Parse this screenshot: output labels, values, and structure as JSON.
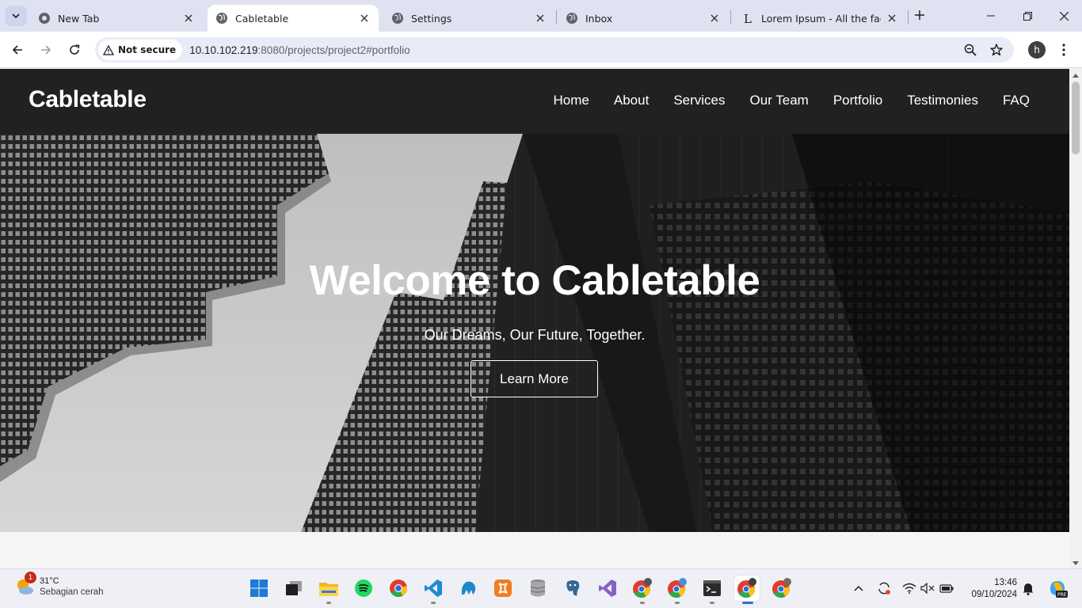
{
  "browser": {
    "tabs": [
      {
        "title": "New Tab",
        "icon": "chrome-icon"
      },
      {
        "title": "Cabletable",
        "icon": "globe-icon",
        "active": true
      },
      {
        "title": "Settings",
        "icon": "settings-globe-icon"
      },
      {
        "title": "Inbox",
        "icon": "globe-icon"
      },
      {
        "title": "Lorem Ipsum - All the facts -",
        "icon": "lorem-l-icon"
      }
    ],
    "security_label": "Not secure",
    "url_host": "10.10.102.219",
    "url_path": ":8080/projects/project2#portfolio",
    "profile_initial": "h"
  },
  "site": {
    "brand": "Cabletable",
    "nav": [
      "Home",
      "About",
      "Services",
      "Our Team",
      "Portfolio",
      "Testimonies",
      "FAQ"
    ],
    "hero": {
      "title": "Welcome to Cabletable",
      "subtitle": "Our Dreams, Our Future, Together.",
      "button": "Learn More"
    }
  },
  "taskbar": {
    "weather_badge": "1",
    "temperature": "31°C",
    "condition": "Sebagian cerah",
    "time": "13:46",
    "date": "09/10/2024",
    "apps": [
      "windows-start-icon",
      "file-explorer-icon",
      "folder-icon",
      "spotify-icon",
      "chrome-icon",
      "vscode-icon",
      "mysql-workbench-icon",
      "xampp-icon",
      "database-icon",
      "postgresql-icon",
      "visual-studio-icon",
      "chrome-profile-icon",
      "chrome-profile-icon",
      "terminal-icon",
      "chrome-icon",
      "chrome-profile-icon"
    ],
    "tray": [
      "chevron-up-icon",
      "sync-icon",
      "wifi-icon",
      "volume-muted-icon",
      "battery-icon",
      "notification-bell-icon",
      "copilot-icon"
    ]
  },
  "colors": {
    "nav_bg": "#212121",
    "tabstrip_bg": "#dfe3f1",
    "accent": "#2f6fd3"
  }
}
